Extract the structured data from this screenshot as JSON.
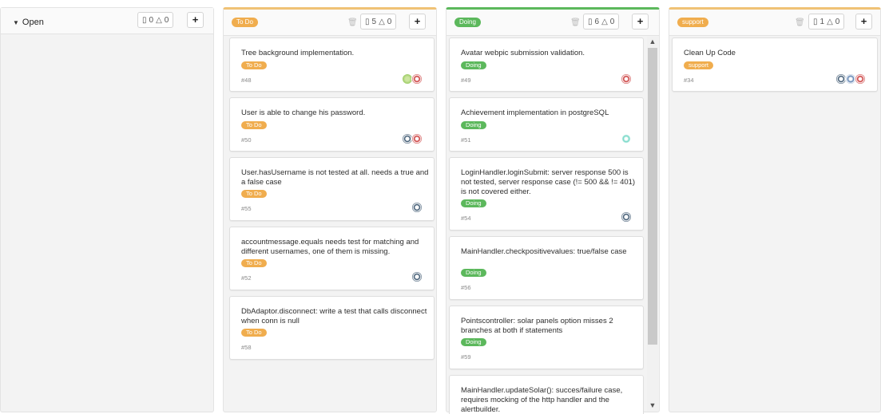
{
  "colors": {
    "todo": "#f0ad4e",
    "doing": "#5cb85c",
    "support": "#f0ad4e",
    "doing_accent": "#5cb85c",
    "todo_accent": "#f0c275"
  },
  "lists": [
    {
      "title": "Open",
      "issues": "0",
      "weight": "0",
      "add": "+"
    },
    {
      "title": "To Do",
      "issues": "5",
      "weight": "0",
      "add": "+",
      "cards": [
        {
          "title": "Tree background implementation.",
          "label": "To Do",
          "num": "#48",
          "avatars": [
            "green-pattern-avatar",
            "red-pattern-avatar"
          ]
        },
        {
          "title": "User is able to change his password.",
          "label": "To Do",
          "num": "#50",
          "avatars": [
            "navy-pattern-avatar",
            "red-pattern-avatar"
          ]
        },
        {
          "title": "User.hasUsername is not tested at all. needs a true and a false case",
          "label": "To Do",
          "num": "#55",
          "avatars": [
            "navy-pattern-avatar"
          ]
        },
        {
          "title": "accountmessage.equals needs test for matching and different usernames, one of them is missing.",
          "label": "To Do",
          "num": "#52",
          "avatars": [
            "navy-pattern-avatar"
          ]
        },
        {
          "title": "DbAdaptor.disconnect: write a test that calls disconnect when conn is null",
          "label": "To Do",
          "num": "#58",
          "avatars": []
        }
      ]
    },
    {
      "title": "Doing",
      "issues": "6",
      "weight": "0",
      "add": "+",
      "cards": [
        {
          "title": "Avatar webpic submission validation.",
          "label": "Doing",
          "num": "#49",
          "avatars": [
            "red-pattern-avatar"
          ]
        },
        {
          "title": "Achievement implementation in postgreSQL",
          "label": "Doing",
          "num": "#51",
          "avatars": [
            "teal-pattern-avatar"
          ]
        },
        {
          "title": "LoginHandler.loginSubmit: server response 500 is not tested, server response case (!= 500 && != 401) is not covered either.",
          "label": "Doing",
          "num": "#54",
          "avatars": [
            "navy-pattern-avatar"
          ]
        },
        {
          "title": "MainHandler.checkpositivevalues: true/false case",
          "label": "Doing",
          "num": "#56",
          "avatars": []
        },
        {
          "title": "Pointscontroller: solar panels option misses 2 branches at both if statements",
          "label": "Doing",
          "num": "#59",
          "avatars": []
        },
        {
          "title": "MainHandler.updateSolar(): succes/failure case, requires mocking of the http handler and the alertbuilder.",
          "label": "",
          "num": "",
          "avatars": []
        }
      ]
    },
    {
      "title": "support",
      "issues": "1",
      "weight": "0",
      "add": "+",
      "cards": [
        {
          "title": "Clean Up Code",
          "label": "support",
          "num": "#34",
          "avatars": [
            "navy-pattern-avatar",
            "blue-pattern-avatar",
            "red-pattern-avatar"
          ]
        }
      ]
    }
  ]
}
